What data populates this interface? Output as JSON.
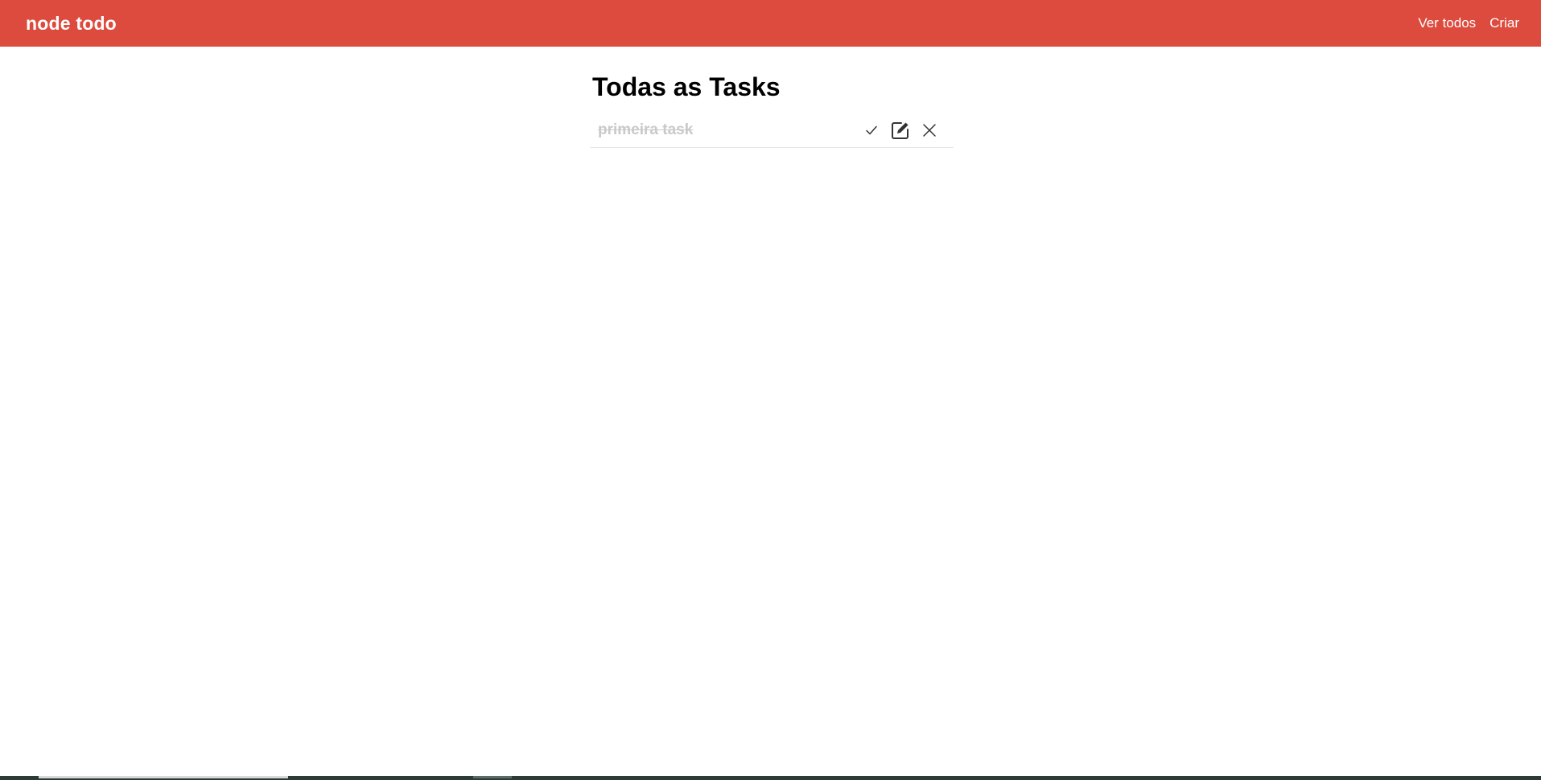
{
  "navbar": {
    "brand": "node todo",
    "links": [
      {
        "label": "Ver todos"
      },
      {
        "label": "Criar"
      }
    ],
    "background_color": "#dc4b3e"
  },
  "main": {
    "title": "Todas as Tasks"
  },
  "tasks": [
    {
      "text": "primeira task",
      "completed": true,
      "actions": [
        "check-icon",
        "edit-icon",
        "close-icon"
      ]
    }
  ]
}
